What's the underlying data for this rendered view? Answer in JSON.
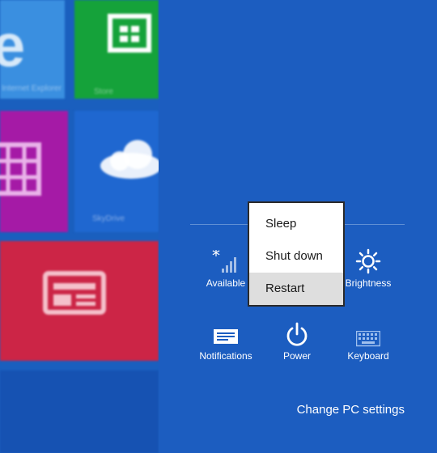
{
  "start_tiles": {
    "ie_label": "Internet Explorer",
    "store_label": "Store",
    "skydrive_label": "SkyDrive"
  },
  "power_menu": {
    "items": [
      {
        "label": "Sleep"
      },
      {
        "label": "Shut down"
      },
      {
        "label": "Restart",
        "highlighted": true
      }
    ]
  },
  "quick_settings": [
    {
      "label": "Available",
      "icon": "network-icon"
    },
    {
      "label": "Brightness",
      "icon": "brightness-icon"
    },
    {
      "label": "Notifications",
      "icon": "notifications-icon"
    },
    {
      "label": "Power",
      "icon": "power-icon"
    },
    {
      "label": "Keyboard",
      "icon": "keyboard-icon"
    }
  ],
  "change_pc_settings": "Change PC settings",
  "colors": {
    "panel_bg": "#1c5dc0",
    "tile_ie": "#3a8fe0",
    "tile_store": "#15a23a",
    "tile_magazine": "#a51aa6",
    "tile_news": "#cc2546",
    "menu_highlight": "#dedede"
  }
}
